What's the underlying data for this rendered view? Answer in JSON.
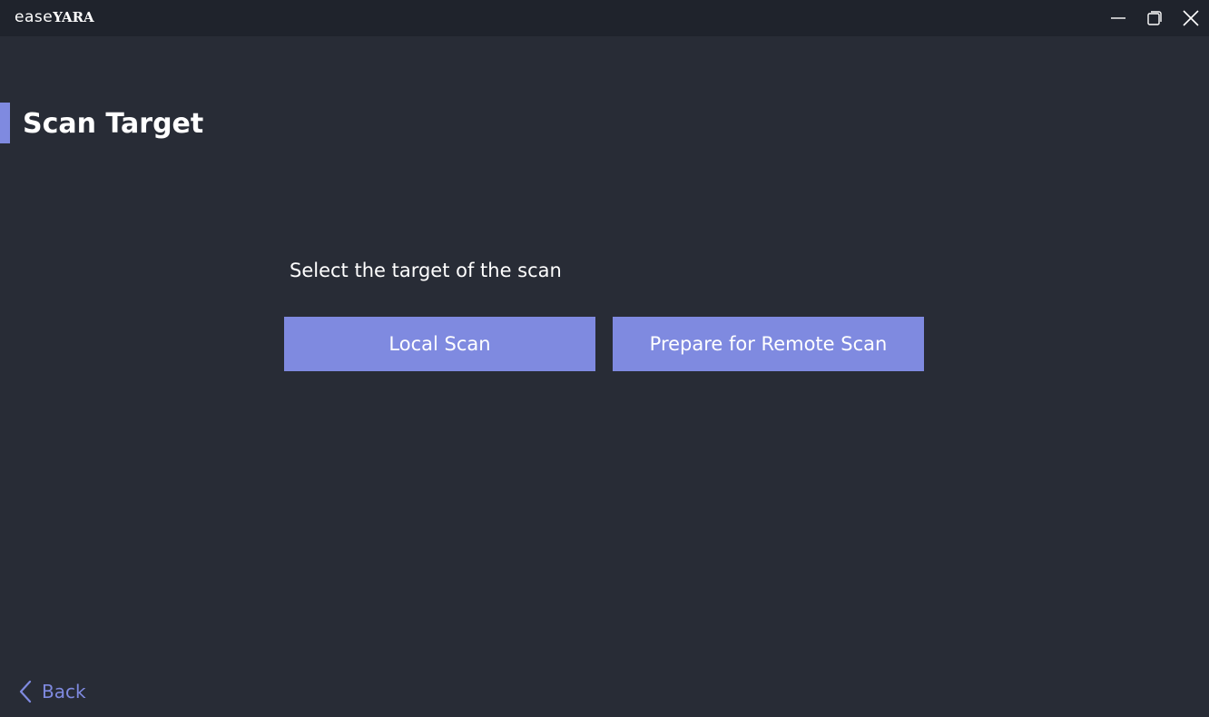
{
  "app": {
    "logo_light": "ease",
    "logo_bold": "YARA"
  },
  "window_controls": {
    "minimize_icon": "minimize-icon",
    "maximize_icon": "maximize-icon",
    "close_icon": "close-icon"
  },
  "page": {
    "title": "Scan Target",
    "prompt": "Select the target of the scan"
  },
  "actions": {
    "local_scan_label": "Local Scan",
    "remote_scan_label": "Prepare for Remote Scan"
  },
  "nav": {
    "back_label": "Back",
    "back_icon": "chevron-left-icon"
  },
  "colors": {
    "background": "#282c36",
    "titlebar": "#1f232c",
    "accent": "#7f8ae0",
    "text": "#ffffff"
  }
}
